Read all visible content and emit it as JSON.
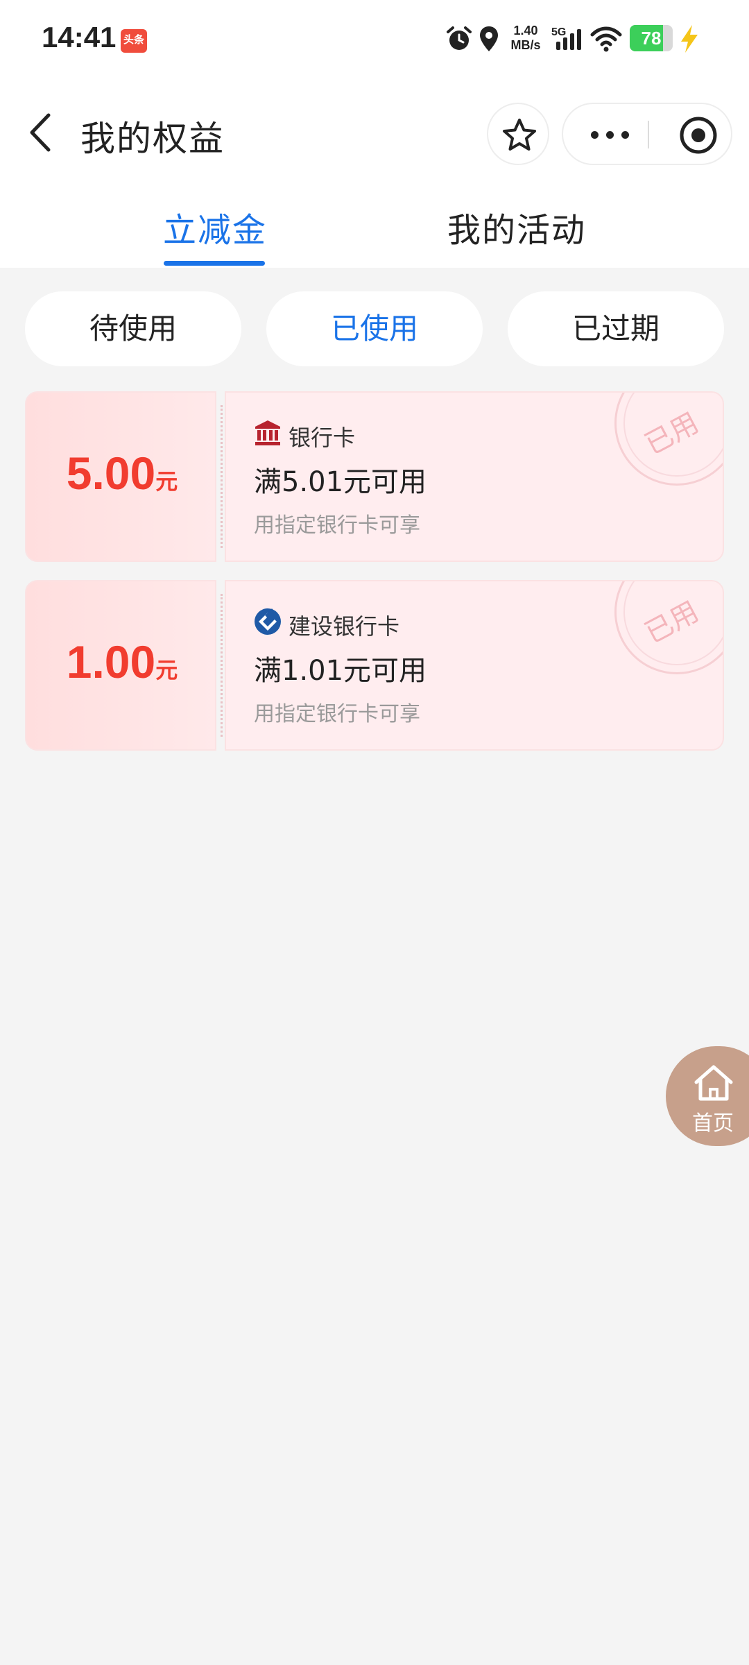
{
  "status_bar": {
    "time": "14:41",
    "app_badge": "头条",
    "net_speed_value": "1.40",
    "net_speed_unit": "MB/s",
    "network_type": "5G",
    "battery_level": "78",
    "battery_fraction": 0.78,
    "icons": [
      "toutiao-app-icon",
      "alarm-icon",
      "location-icon",
      "signal-icon",
      "wifi-icon",
      "battery-icon",
      "charging-bolt-icon"
    ]
  },
  "header": {
    "title": "我的权益",
    "icons": [
      "back-arrow-icon",
      "star-icon",
      "more-dots-icon",
      "target-icon"
    ]
  },
  "tabs": [
    {
      "label": "立减金",
      "active": true
    },
    {
      "label": "我的活动",
      "active": false
    }
  ],
  "filters": [
    {
      "label": "待使用",
      "active": false
    },
    {
      "label": "已使用",
      "active": true
    },
    {
      "label": "已过期",
      "active": false
    }
  ],
  "coupons": [
    {
      "amount": "5.00",
      "unit": "元",
      "bank_icon": "bank-building-icon",
      "bank_name": "银行卡",
      "condition": "满5.01元可用",
      "note": "用指定银行卡可享",
      "stamp": "已用"
    },
    {
      "amount": "1.00",
      "unit": "元",
      "bank_icon": "ccb-logo-icon",
      "bank_name": "建设银行卡",
      "condition": "满1.01元可用",
      "note": "用指定银行卡可享",
      "stamp": "已用"
    }
  ],
  "home_button": {
    "label": "首页",
    "icon": "home-icon"
  },
  "colors": {
    "accent": "#1a73e8",
    "amount_red": "#f13c2f",
    "coupon_bg": "#ffedef",
    "page_bg": "#f4f4f4",
    "home_fab": "#c7a08b"
  }
}
